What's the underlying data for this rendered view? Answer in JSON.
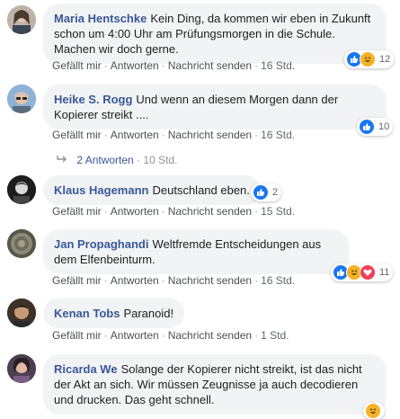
{
  "comments": [
    {
      "author": "Maria Hentschke",
      "text": "Kein Ding, da kommen wir eben in Zukunft schon um 4:00 Uhr am Prüfungsmorgen in die Schule. Machen wir doch gerne.",
      "like": "Gefällt mir",
      "reply": "Antworten",
      "message": "Nachricht senden",
      "time": "16 Std.",
      "reaction_count": "12"
    },
    {
      "author": "Heike S. Rogg",
      "text": "Und wenn an diesem Morgen dann der Kopierer streikt ....",
      "like": "Gefällt mir",
      "reply": "Antworten",
      "message": "Nachricht senden",
      "time": "16 Std.",
      "reaction_count": "10",
      "replies_label": "2 Antworten",
      "replies_time": "10 Std."
    },
    {
      "author": "Klaus Hagemann",
      "text": "Deutschland eben.",
      "like": "Gefällt mir",
      "reply": "Antworten",
      "message": "Nachricht senden",
      "time": "15 Std.",
      "reaction_count": "2"
    },
    {
      "author": "Jan Propaghandi",
      "text": "Weltfremde Entscheidungen aus dem Elfenbeinturm.",
      "like": "Gefällt mir",
      "reply": "Antworten",
      "message": "Nachricht senden",
      "time": "16 Std.",
      "reaction_count": "11"
    },
    {
      "author": "Kenan Tobs",
      "text": "Paranoid!",
      "like": "Gefällt mir",
      "reply": "Antworten",
      "message": "Nachricht senden",
      "time": "1 Std."
    },
    {
      "author": "Ricarda We",
      "text": "Solange der Kopierer nicht streikt, ist das nicht der Akt an sich. Wir müssen Zeugnisse ja auch decodieren und drucken. Das geht schnell."
    }
  ],
  "colors": {
    "author": "#385898",
    "bubble": "#f2f3f5",
    "meta": "#616770",
    "like": "#1877f2",
    "haha": "#f7b125",
    "love": "#f33e58"
  }
}
